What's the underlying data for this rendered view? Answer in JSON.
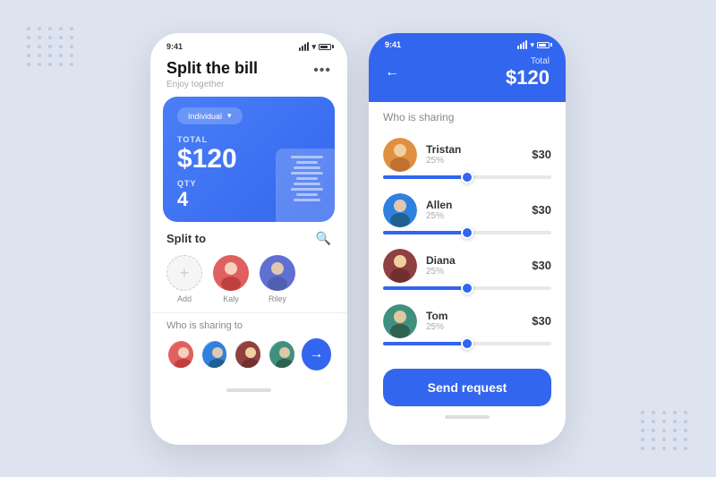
{
  "background": "#dde4f0",
  "leftPhone": {
    "statusBar": {
      "time": "9:41"
    },
    "header": {
      "title": "Split the bill",
      "subtitle": "Enjoy together",
      "moreLabel": "•••"
    },
    "blueCard": {
      "dropdownLabel": "Individual",
      "totalLabel": "TOTAL",
      "totalAmount": "$120",
      "qtyLabel": "QTY",
      "qtyValue": "4"
    },
    "splitSection": {
      "title": "Split to",
      "addLabel": "Add",
      "people": [
        {
          "name": "Kaly",
          "colorClass": "av-kaly"
        },
        {
          "name": "Riley",
          "colorClass": "av-riley"
        }
      ]
    },
    "sharingSection": {
      "title": "Who is sharing to",
      "arrowLabel": "→"
    }
  },
  "rightPhone": {
    "statusBar": {
      "time": "9:41"
    },
    "topBar": {
      "backLabel": "←",
      "totalLabel": "Total",
      "totalAmount": "$120"
    },
    "sharingTitle": "Who is sharing",
    "people": [
      {
        "name": "Tristan",
        "pct": "25%",
        "amount": "$30",
        "fillPct": 50,
        "colorClass": "av-tristan"
      },
      {
        "name": "Allen",
        "pct": "25%",
        "amount": "$30",
        "fillPct": 50,
        "colorClass": "av-allen"
      },
      {
        "name": "Diana",
        "pct": "25%",
        "amount": "$30",
        "fillPct": 50,
        "colorClass": "av-diana"
      },
      {
        "name": "Tom",
        "pct": "25%",
        "amount": "$30",
        "fillPct": 50,
        "colorClass": "av-tom"
      }
    ],
    "sendButton": "Send request"
  }
}
